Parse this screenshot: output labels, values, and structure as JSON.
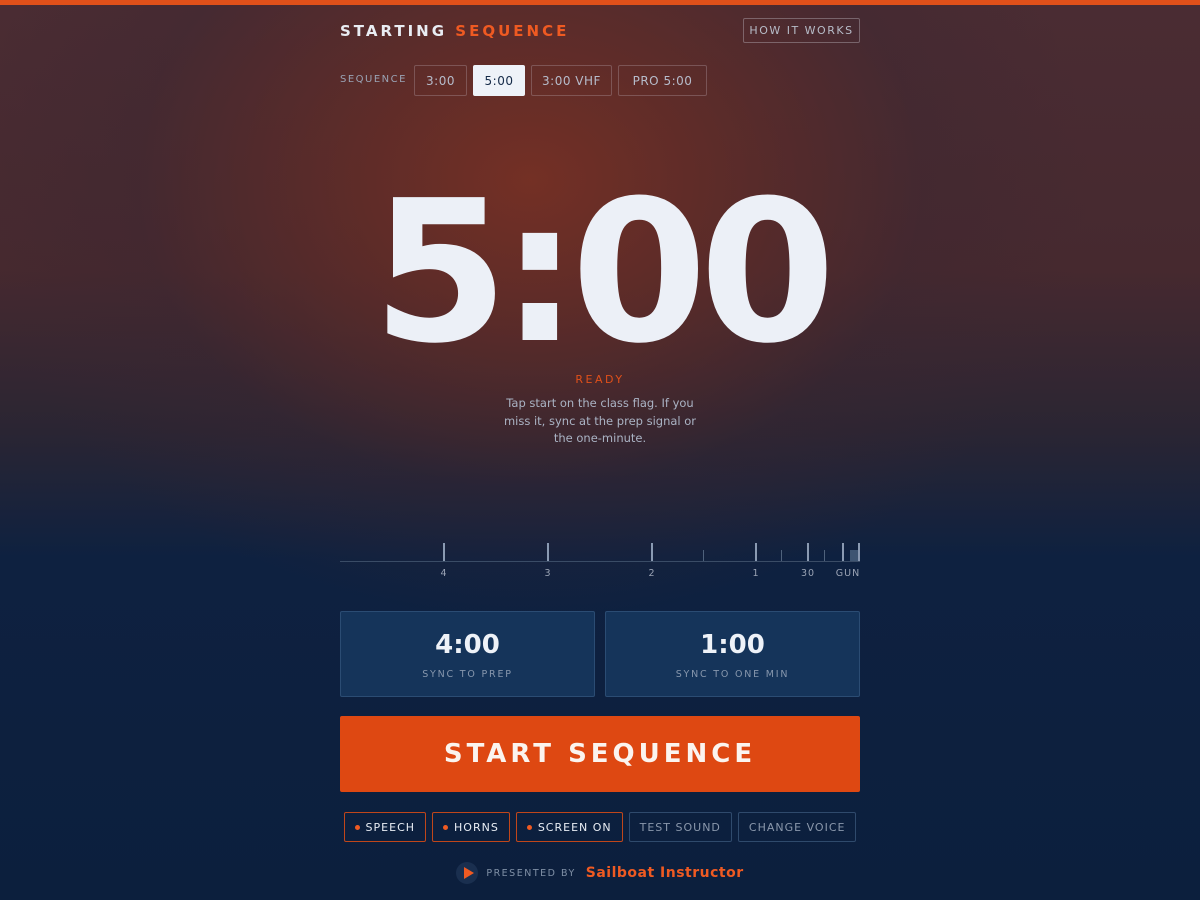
{
  "header": {
    "title_main": "STARTING",
    "title_accent": "SEQUENCE",
    "how_label": "HOW IT WORKS"
  },
  "sequence": {
    "label": "SEQUENCE",
    "options": [
      "3:00",
      "5:00",
      "3:00 VHF",
      "PRO 5:00"
    ],
    "selected": "5:00"
  },
  "timer": {
    "display": "5:00",
    "status": "READY",
    "hint": "Tap start on the class flag. If you miss it, sync at the prep signal or the one-minute."
  },
  "timeline": {
    "labels": [
      "4",
      "3",
      "2",
      "1",
      "30",
      "GUN"
    ]
  },
  "sync": [
    {
      "time": "4:00",
      "label": "SYNC TO PREP"
    },
    {
      "time": "1:00",
      "label": "SYNC TO ONE MIN"
    }
  ],
  "start": {
    "label": "START SEQUENCE"
  },
  "toggles": [
    {
      "label": "SPEECH",
      "active": true
    },
    {
      "label": "HORNS",
      "active": true
    },
    {
      "label": "SCREEN ON",
      "active": true
    },
    {
      "label": "TEST SOUND",
      "active": false
    },
    {
      "label": "CHANGE VOICE",
      "active": false
    }
  ],
  "footer": {
    "presented": "PRESENTED BY",
    "brand": "Sailboat Instructor"
  },
  "colors": {
    "accent": "#e0501a",
    "navy": "#0c1f3d",
    "panel": "#15345a"
  }
}
